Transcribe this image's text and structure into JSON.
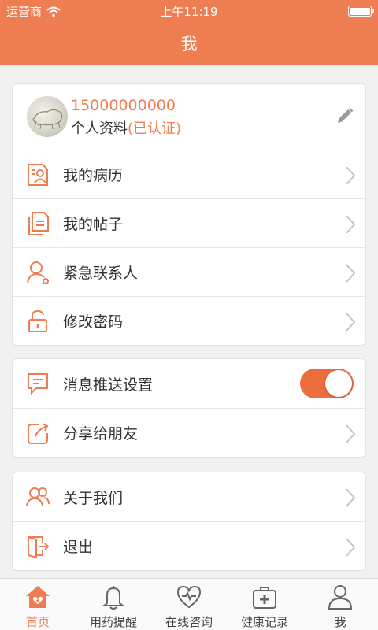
{
  "status_bar": {
    "carrier": "运营商",
    "time": "上午11:19"
  },
  "nav": {
    "title": "我"
  },
  "profile": {
    "phone": "15000000000",
    "info_label": "个人资料",
    "verified_label": "(已认证)"
  },
  "group1": [
    {
      "label": "我的病历",
      "icon": "medical-record-icon"
    },
    {
      "label": "我的帖子",
      "icon": "posts-icon"
    },
    {
      "label": "紧急联系人",
      "icon": "contact-person-icon"
    },
    {
      "label": "修改密码",
      "icon": "lock-icon"
    }
  ],
  "group2": [
    {
      "label": "消息推送设置",
      "icon": "message-icon",
      "toggle_on": true
    },
    {
      "label": "分享给朋友",
      "icon": "share-icon"
    }
  ],
  "group3": [
    {
      "label": "关于我们",
      "icon": "people-icon"
    },
    {
      "label": "退出",
      "icon": "logout-icon"
    }
  ],
  "tabs": [
    {
      "label": "首页",
      "icon": "home-icon",
      "active": true
    },
    {
      "label": "用药提醒",
      "icon": "bell-icon",
      "active": false
    },
    {
      "label": "在线咨询",
      "icon": "heart-stethoscope-icon",
      "active": false
    },
    {
      "label": "健康记录",
      "icon": "medical-kit-icon",
      "active": false
    },
    {
      "label": "我",
      "icon": "user-icon",
      "active": false
    }
  ],
  "colors": {
    "accent": "#ef7d52",
    "toggle_on": "#ee6d3e",
    "background": "#f1f1f1"
  }
}
